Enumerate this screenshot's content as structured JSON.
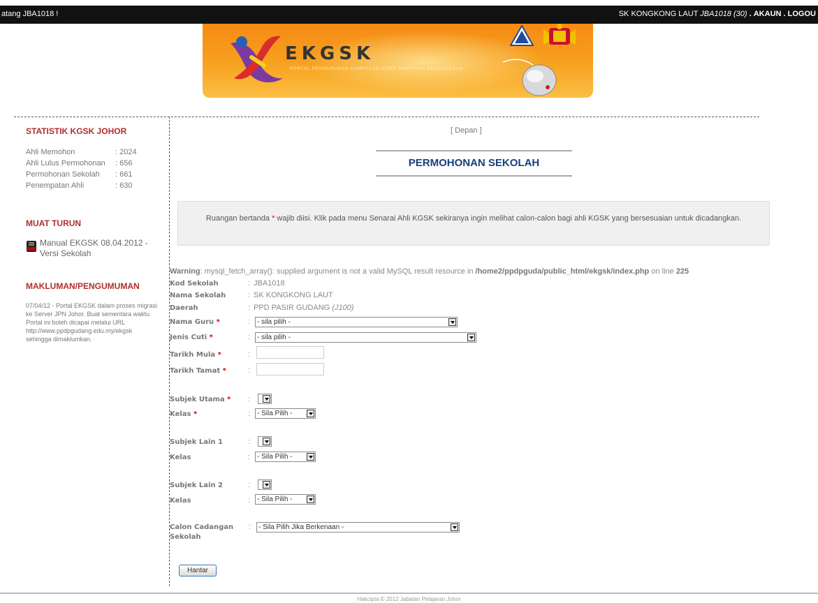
{
  "topbar": {
    "welcome": "atang JBA1018 !",
    "school": "SK KONGKONG LAUT",
    "user_code": "JBA1018 (30)",
    "sep1": ".",
    "account_link": "AKAUN",
    "sep2": ".",
    "logout_link": "LOGOU"
  },
  "banner": {
    "brand": "EKGSK",
    "tagline": "PORTAL PENGURUSAN KUMPULAN GURU SIMPANAN KEBANGSAAN"
  },
  "sidebar": {
    "stats_title": "STATISTIK KGSK JOHOR",
    "stats": [
      {
        "label": "Ahli Memohon",
        "value": ": 2024"
      },
      {
        "label": "Ahli Lulus Permohonan",
        "value": ": 656"
      },
      {
        "label": "Permohonan Sekolah",
        "value": ": 661"
      },
      {
        "label": "Penempatan Ahli",
        "value": ": 630"
      }
    ],
    "download_title": "MUAT TURUN",
    "download_link": "Manual EKGSK 08.04.2012 - Versi Sekolah",
    "news_title": "MAKLUMAN/PENGUMUMAN",
    "news_text": "07/04/12 - Portal EKGSK dalam proses migrasi ke Server JPN Johor. Buat sementara waktu Portal ini boleh dicapai melalui URL http://www.ppdpgudang.edu.my/ekgsk sehingga dimaklumkan."
  },
  "main": {
    "breadcrumb": "[ Depan ]",
    "title": "PERMOHONAN SEKOLAH",
    "notice_pre": "Ruangan bertanda ",
    "notice_star": "*",
    "notice_post": " wajib diisi. Klik pada menu Senarai Ahli KGSK sekiranya ingin melihat calon-calon bagi ahli KGSK yang bersesuaian untuk dicadangkan.",
    "warning_label": "Warning",
    "warning_text": ": mysql_fetch_array(): supplied argument is not a valid MySQL result resource in ",
    "warning_path": "/home2/ppdpguda/public_html/ekgsk/index.php",
    "warning_on": " on line ",
    "warning_line": "225"
  },
  "form": {
    "kod_label": "Kod Sekolah",
    "kod_value": "JBA1018",
    "nama_sekolah_label": "Nama Sekolah",
    "nama_sekolah_value": "SK KONGKONG LAUT",
    "daerah_label": "Daerah",
    "daerah_value": "PPD PASIR GUDANG",
    "daerah_code": "(J100)",
    "nama_guru_label": "Nama Guru",
    "nama_guru_value": "- sila pilih -",
    "jenis_cuti_label": "Jenis Cuti",
    "jenis_cuti_value": "- sila pilih -",
    "tarikh_mula_label": "Tarikh Mula",
    "tarikh_tamat_label": "Tarikh Tamat",
    "subjek_utama_label": "Subjek Utama",
    "kelas_label": "Kelas",
    "kelas_value": "- Sila Pilih -",
    "subjek_lain1_label": "Subjek Lain 1",
    "subjek_lain2_label": "Subjek Lain 2",
    "calon_label": "Calon Cadangan Sekolah",
    "calon_value": "- Sila Pilih Jika Berkenaan -",
    "required_mark": "*",
    "colon": ":",
    "submit": "Hantar"
  },
  "footer": {
    "text": "Hakcipta © 2012 Jabatan Pelajaran Johor"
  },
  "colors": {
    "topbar": "#111111",
    "banner": "#f7a221",
    "sidebar_heading": "#b02e2e",
    "title": "#1a3f7a",
    "required": "#dd0000"
  }
}
